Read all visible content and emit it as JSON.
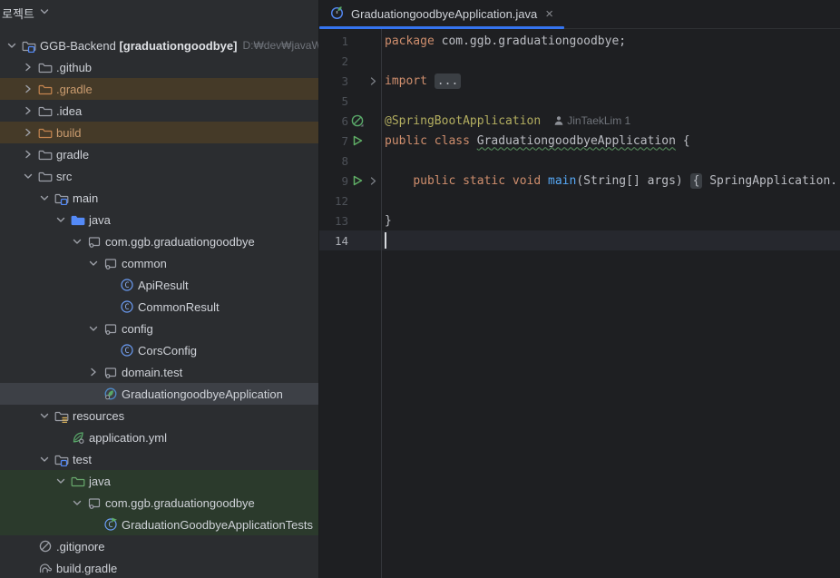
{
  "colors": {
    "sidebar_bg": "#2B2D30",
    "editor_bg": "#1E1F22",
    "accent_blue": "#3574F0",
    "excluded_row_bg": "#453A28",
    "test_row_bg": "#2B3A2C",
    "selected_row_bg": "#3D4046",
    "caret_line_bg": "#26282E",
    "keyword": "#CF8E6D",
    "annotation": "#B3AE60",
    "method": "#56A8F5",
    "default_text": "#BCBEC4",
    "run_green": "#5FAD65",
    "spring_green": "#59A869",
    "class_blue": "#77A4F7"
  },
  "sidebar": {
    "header": {
      "title": "로젝트",
      "chevron_icon": "chevron-down"
    },
    "tree": [
      {
        "label": "GGB-Backend ",
        "label_bold": "[graduationgoodbye]",
        "path": "D:₩dev₩javaWorkspa",
        "level": 0,
        "arrow": "expanded",
        "icon": "project-root",
        "row": ""
      },
      {
        "label": ".github",
        "level": 1,
        "arrow": "collapsed",
        "icon": "folder",
        "row": ""
      },
      {
        "label": ".gradle",
        "level": 1,
        "arrow": "collapsed",
        "icon": "folder-excluded",
        "row": "excluded"
      },
      {
        "label": ".idea",
        "level": 1,
        "arrow": "collapsed",
        "icon": "folder",
        "row": ""
      },
      {
        "label": "build",
        "level": 1,
        "arrow": "collapsed",
        "icon": "folder-excluded",
        "row": "excluded"
      },
      {
        "label": "gradle",
        "level": 1,
        "arrow": "collapsed",
        "icon": "folder",
        "row": ""
      },
      {
        "label": "src",
        "level": 1,
        "arrow": "expanded",
        "icon": "folder",
        "row": ""
      },
      {
        "label": "main",
        "level": 2,
        "arrow": "expanded",
        "icon": "module-root",
        "row": ""
      },
      {
        "label": "java",
        "level": 3,
        "arrow": "expanded",
        "icon": "sources-folder",
        "row": ""
      },
      {
        "label": "com.ggb.graduationgoodbye",
        "level": 4,
        "arrow": "expanded",
        "icon": "package",
        "row": ""
      },
      {
        "label": "common",
        "level": 5,
        "arrow": "expanded",
        "icon": "package",
        "row": ""
      },
      {
        "label": "ApiResult",
        "level": 6,
        "arrow": "",
        "icon": "class",
        "row": ""
      },
      {
        "label": "CommonResult",
        "level": 6,
        "arrow": "",
        "icon": "class",
        "row": ""
      },
      {
        "label": "config",
        "level": 5,
        "arrow": "expanded",
        "icon": "package",
        "row": ""
      },
      {
        "label": "CorsConfig",
        "level": 6,
        "arrow": "",
        "icon": "class",
        "row": ""
      },
      {
        "label": "domain.test",
        "level": 5,
        "arrow": "collapsed",
        "icon": "package",
        "row": ""
      },
      {
        "label": "GraduationgoodbyeApplication",
        "level": 5,
        "arrow": "",
        "icon": "spring-app",
        "row": "selected"
      },
      {
        "label": "resources",
        "level": 2,
        "arrow": "expanded",
        "icon": "resources-root",
        "row": ""
      },
      {
        "label": "application.yml",
        "level": 3,
        "arrow": "",
        "icon": "spring-yml",
        "row": ""
      },
      {
        "label": "test",
        "level": 2,
        "arrow": "expanded",
        "icon": "module-root",
        "row": ""
      },
      {
        "label": "java",
        "level": 3,
        "arrow": "expanded",
        "icon": "test-folder",
        "row": "test"
      },
      {
        "label": "com.ggb.graduationgoodbye",
        "level": 4,
        "arrow": "expanded",
        "icon": "package",
        "row": "test"
      },
      {
        "label": "GraduationGoodbyeApplicationTests",
        "level": 5,
        "arrow": "",
        "icon": "test-class",
        "row": "test"
      },
      {
        "label": ".gitignore",
        "level": 1,
        "arrow": "",
        "icon": "ignored",
        "row": ""
      },
      {
        "label": "build.gradle",
        "level": 1,
        "arrow": "",
        "icon": "gradle",
        "row": ""
      }
    ]
  },
  "editor": {
    "tab": {
      "icon": "spring-boot-tab",
      "title": "GraduationgoodbyeApplication.java",
      "close_label": "×"
    },
    "lines": [
      {
        "num": "1",
        "gutter": "",
        "fold": false,
        "current": false,
        "segments": [
          {
            "c": "kw",
            "text": "package "
          },
          {
            "c": "def",
            "text": "com.ggb.graduationgoodbye;"
          }
        ]
      },
      {
        "num": "2",
        "gutter": "",
        "fold": false,
        "current": false,
        "segments": []
      },
      {
        "num": "3",
        "gutter": "",
        "fold": true,
        "current": false,
        "segments": [
          {
            "c": "kw",
            "text": "import "
          },
          {
            "c": "fold",
            "text": "..."
          }
        ]
      },
      {
        "num": "5",
        "gutter": "",
        "fold": false,
        "current": false,
        "segments": []
      },
      {
        "num": "6",
        "gutter": "spring-bean",
        "fold": false,
        "current": false,
        "segments": [
          {
            "c": "ann",
            "text": "@SpringBootApplication"
          }
        ],
        "inlay": "JinTaekLim 1"
      },
      {
        "num": "7",
        "gutter": "run",
        "fold": false,
        "current": false,
        "segments": [
          {
            "c": "kw",
            "text": "public class "
          },
          {
            "c": "cls",
            "text": "GraduationgoodbyeApplication"
          },
          {
            "c": "def",
            "text": " {"
          }
        ]
      },
      {
        "num": "8",
        "gutter": "",
        "fold": false,
        "current": false,
        "segments": []
      },
      {
        "num": "9",
        "gutter": "run",
        "fold": true,
        "current": false,
        "segments": [
          {
            "c": "def",
            "text": "    "
          },
          {
            "c": "kw",
            "text": "public static void "
          },
          {
            "c": "mtd",
            "text": "main"
          },
          {
            "c": "def",
            "text": "(String[] args) "
          },
          {
            "c": "fold",
            "text": "{"
          },
          {
            "c": "def",
            "text": " SpringApplication."
          }
        ]
      },
      {
        "num": "12",
        "gutter": "",
        "fold": false,
        "current": false,
        "segments": []
      },
      {
        "num": "13",
        "gutter": "",
        "fold": false,
        "current": false,
        "segments": [
          {
            "c": "def",
            "text": "}"
          }
        ]
      },
      {
        "num": "14",
        "gutter": "",
        "fold": false,
        "current": true,
        "caret": true,
        "segments": []
      }
    ]
  }
}
